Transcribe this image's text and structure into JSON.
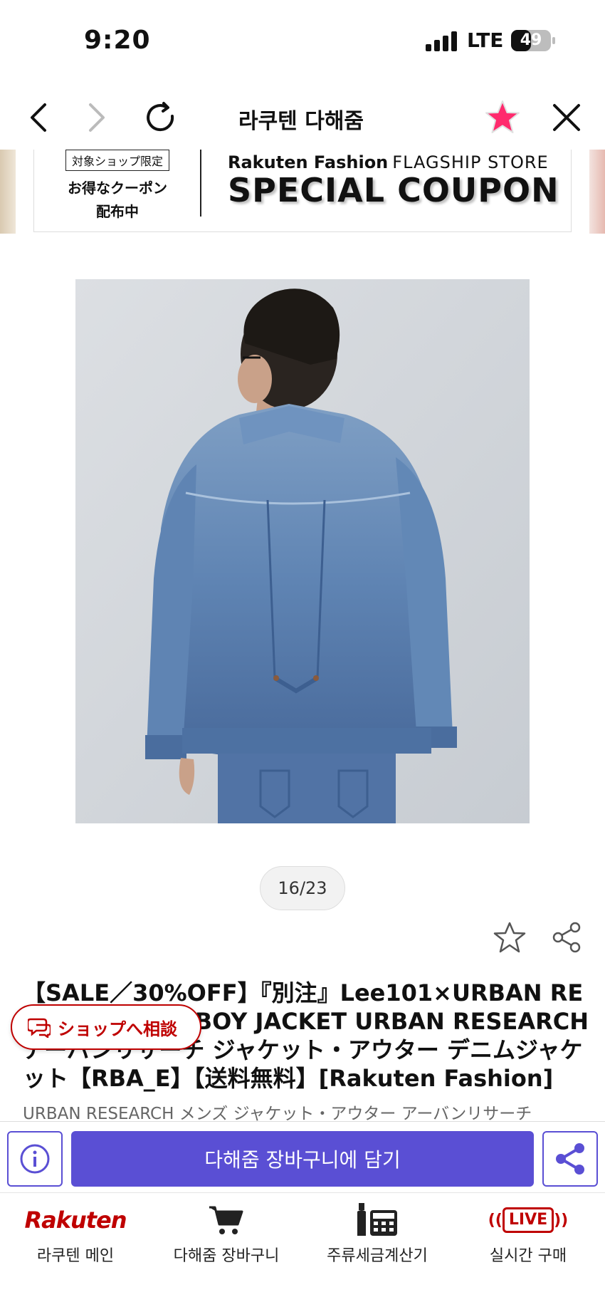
{
  "status": {
    "time": "9:20",
    "network": "LTE",
    "battery": "49"
  },
  "nav": {
    "title": "라쿠텐 다해줌"
  },
  "banner": {
    "tag": "対象ショップ限定",
    "line1": "お得なクーポン",
    "line2": "配布中",
    "brand": "Rakuten Fashion",
    "flagship": "FLAGSHIP STORE",
    "headline": "SPECIAL COUPON"
  },
  "gallery": {
    "counter": "16/23"
  },
  "product": {
    "title": "【SALE／30%OFF】『別注』Lee101×URBAN RESEARCH COWBOY JACKET URBAN RESEARCH アーバンリサーチ ジャケット・アウター デニムジャケット【RBA_E】【送料無料】[Rakuten Fashion]",
    "meta": "URBAN RESEARCH メンズ ジャケット・アウター アーバンリサーチ"
  },
  "chat": {
    "label": "ショップへ相談"
  },
  "actions": {
    "cart_label": "다해줌 장바구니에 담기"
  },
  "tabs": [
    {
      "logo": "Rakuten",
      "label": "라쿠텐 메인"
    },
    {
      "label": "다해줌 장바구니"
    },
    {
      "label": "주류세금계산기"
    },
    {
      "live": "LIVE",
      "label": "실시간 구매"
    }
  ],
  "colors": {
    "accent": "#5a4fd4",
    "rakuten_red": "#bf0000",
    "star": "#ff2a6d"
  }
}
